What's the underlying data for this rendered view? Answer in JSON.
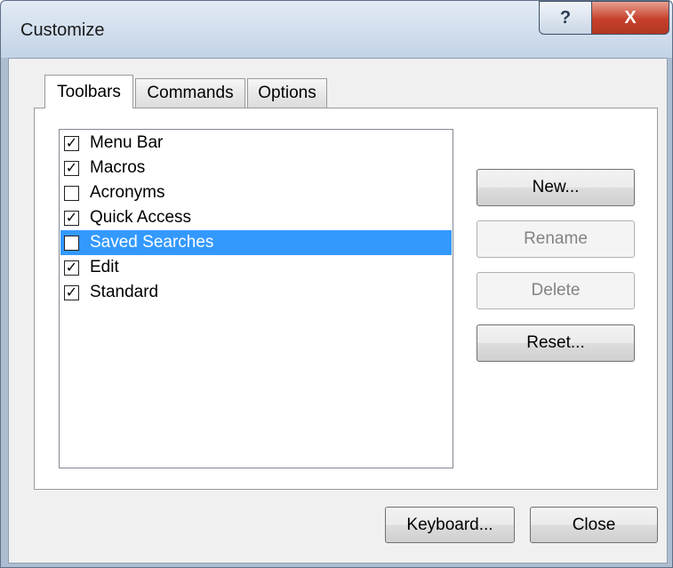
{
  "window": {
    "title": "Customize",
    "help_glyph": "?",
    "close_glyph": "X"
  },
  "tabs": [
    {
      "label": "Toolbars",
      "active": true
    },
    {
      "label": "Commands",
      "active": false
    },
    {
      "label": "Options",
      "active": false
    }
  ],
  "toolbars_list": [
    {
      "label": "Menu Bar",
      "checked": true,
      "selected": false
    },
    {
      "label": "Macros",
      "checked": true,
      "selected": false
    },
    {
      "label": "Acronyms",
      "checked": false,
      "selected": false
    },
    {
      "label": "Quick Access",
      "checked": true,
      "selected": false
    },
    {
      "label": "Saved Searches",
      "checked": false,
      "selected": true
    },
    {
      "label": "Edit",
      "checked": true,
      "selected": false
    },
    {
      "label": "Standard",
      "checked": true,
      "selected": false
    }
  ],
  "side_buttons": {
    "new": {
      "label": "New...",
      "enabled": true
    },
    "rename": {
      "label": "Rename",
      "enabled": false
    },
    "delete": {
      "label": "Delete",
      "enabled": false
    },
    "reset": {
      "label": "Reset...",
      "enabled": true
    }
  },
  "footer": {
    "keyboard_label": "Keyboard...",
    "close_label": "Close"
  },
  "colors": {
    "selection": "#3399ff",
    "close_button": "#c6402c"
  }
}
